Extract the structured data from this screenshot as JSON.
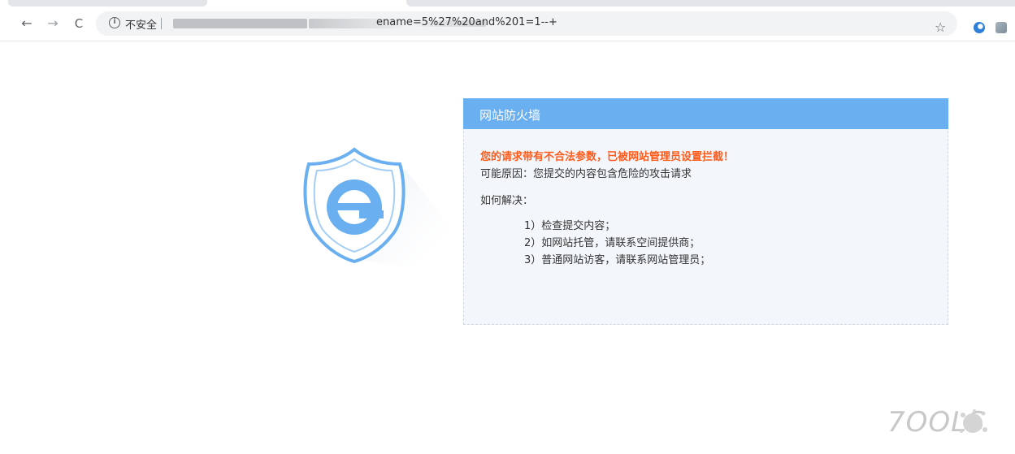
{
  "browser": {
    "nav": {
      "back": "←",
      "forward": "→",
      "reload": "C"
    },
    "address_bar": {
      "security_text": "不安全",
      "url_visible": "ename=5%27%20and%201=1--+"
    },
    "bookmark_star": "☆"
  },
  "page": {
    "panel_title": "网站防火墙",
    "warning": "您的请求带有不合法参数，已被网站管理员设置拦截！",
    "reason": "可能原因：您提交的内容包含危险的攻击请求",
    "solve_label": "如何解决：",
    "steps": [
      "1）检查提交内容；",
      "2）如网站托管，请联系空间提供商；",
      "3）普通网站访客，请联系网站管理员；"
    ],
    "colors": {
      "header": "#6aafef",
      "warning": "#ff5a1a",
      "panel_bg": "#f3f7fb",
      "shield": "#6aafef"
    }
  },
  "watermark": {
    "text": "7OOLS"
  }
}
